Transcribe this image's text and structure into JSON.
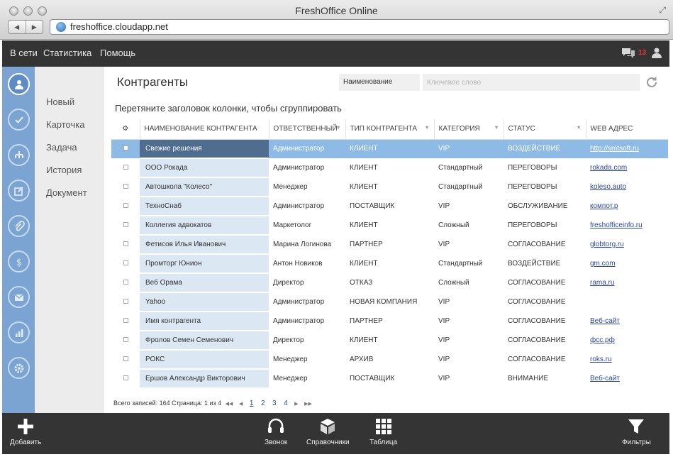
{
  "window": {
    "title": "FreshOffice Online",
    "url": "freshoffice.cloudapp.net"
  },
  "menubar": {
    "items": [
      "В сети",
      "Статистика",
      "Помощь"
    ],
    "notification_count": "13"
  },
  "side_menu": {
    "items": [
      "Новый",
      "Карточка",
      "Задача",
      "История",
      "Документ"
    ]
  },
  "main": {
    "title": "Контрагенты",
    "search_field": "Наименование",
    "search_placeholder": "Ключевое слово",
    "group_hint": "Перетяните заголовок колонки, чтобы сгруппировать"
  },
  "table": {
    "columns": [
      "НАИМЕНОВАНИЕ КОНТРАГЕНТА",
      "ОТВЕТСТВЕННЫЙ",
      "ТИП КОНТРАГЕНТА",
      "КАТЕГОРИЯ",
      "СТАТУС",
      "WEB АДРЕС"
    ],
    "rows": [
      [
        "Свежие решения",
        "Администратор",
        "КЛИЕНТ",
        "VIP",
        "ВОЗДЕЙСТВИЕ",
        "http://smtsoft.ru"
      ],
      [
        "ООО Рокада",
        "Администратор",
        "КЛИЕНТ",
        "Стандартный",
        "ПЕРЕГОВОРЫ",
        "rokada.com"
      ],
      [
        "Автошкола \"Колесо\"",
        "Менеджер",
        "КЛИЕНТ",
        "Стандартный",
        "ПЕРЕГОВОРЫ",
        "koleso.auto"
      ],
      [
        "ТехноСнаб",
        "Администратор",
        "ПОСТАВЩИК",
        "VIP",
        "ОБСЛУЖИВАНИЕ",
        "компот.р"
      ],
      [
        "Коллегия адвокатов",
        "Маркетолог",
        "КЛИЕНТ",
        "Сложный",
        "ПЕРЕГОВОРЫ",
        "freshofficeinfo.ru"
      ],
      [
        "Фетисов Илья Иванович",
        "Марина Логинова",
        "ПАРТНЕР",
        "VIP",
        "СОГЛАСОВАНИЕ",
        "globtorg.ru"
      ],
      [
        "Промторг Юнион",
        "Антон Новиков",
        "КЛИЕНТ",
        "Стандартный",
        "ВОЗДЕЙСТВИЕ",
        "gm.com"
      ],
      [
        "Веб Орама",
        "Директор",
        "ОТКАЗ",
        "Сложный",
        "СОГЛАСОВАНИЕ",
        "rama.ru"
      ],
      [
        "Yahoo",
        "Администратор",
        "НОВАЯ КОМПАНИЯ",
        "VIP",
        "СОГЛАСОВАНИЕ",
        ""
      ],
      [
        "Имя контрагента",
        "Администратор",
        "ПАРТНЕР",
        "VIP",
        "СОГЛАСОВАНИЕ",
        "Веб-сайт"
      ],
      [
        "Фролов Семен Семенович",
        "Директор",
        "КЛИЕНТ",
        "VIP",
        "СОГЛАСОВАНИЕ",
        "фсс.рф"
      ],
      [
        "РОКС",
        "Менеджер",
        "АРХИВ",
        "VIP",
        "СОГЛАСОВАНИЕ",
        "roks.ru"
      ],
      [
        "Ершов Александр Викторович",
        "Менеджер",
        "ПОСТАВЩИК",
        "VIP",
        "ВНИМАНИЕ",
        "Веб-сайт"
      ]
    ],
    "selected_row": 0
  },
  "pager": {
    "summary": "Всего записей: 164 Страница: 1 из 4",
    "pages": [
      "1",
      "2",
      "3",
      "4"
    ],
    "current_page": "1"
  },
  "toolbar": {
    "add_label": "Добавить",
    "call_label": "Звонок",
    "refs_label": "Справочники",
    "table_label": "Таблица",
    "filters_label": "Фильтры"
  },
  "colors": {
    "menubar_bg": "#343434",
    "sidebar_bg": "#7ba4d3",
    "selected_row": "#8dbbe6",
    "selected_name": "#4e6d8f",
    "name_column": "#dbe7f3",
    "link": "#2a45a8",
    "notification": "#e23b3b"
  },
  "icons": {
    "sidebar": [
      "user-icon",
      "check-icon",
      "org-chart-icon",
      "edit-icon",
      "paperclip-icon",
      "dollar-icon",
      "mail-icon",
      "stats-icon",
      "settings-icon"
    ]
  }
}
